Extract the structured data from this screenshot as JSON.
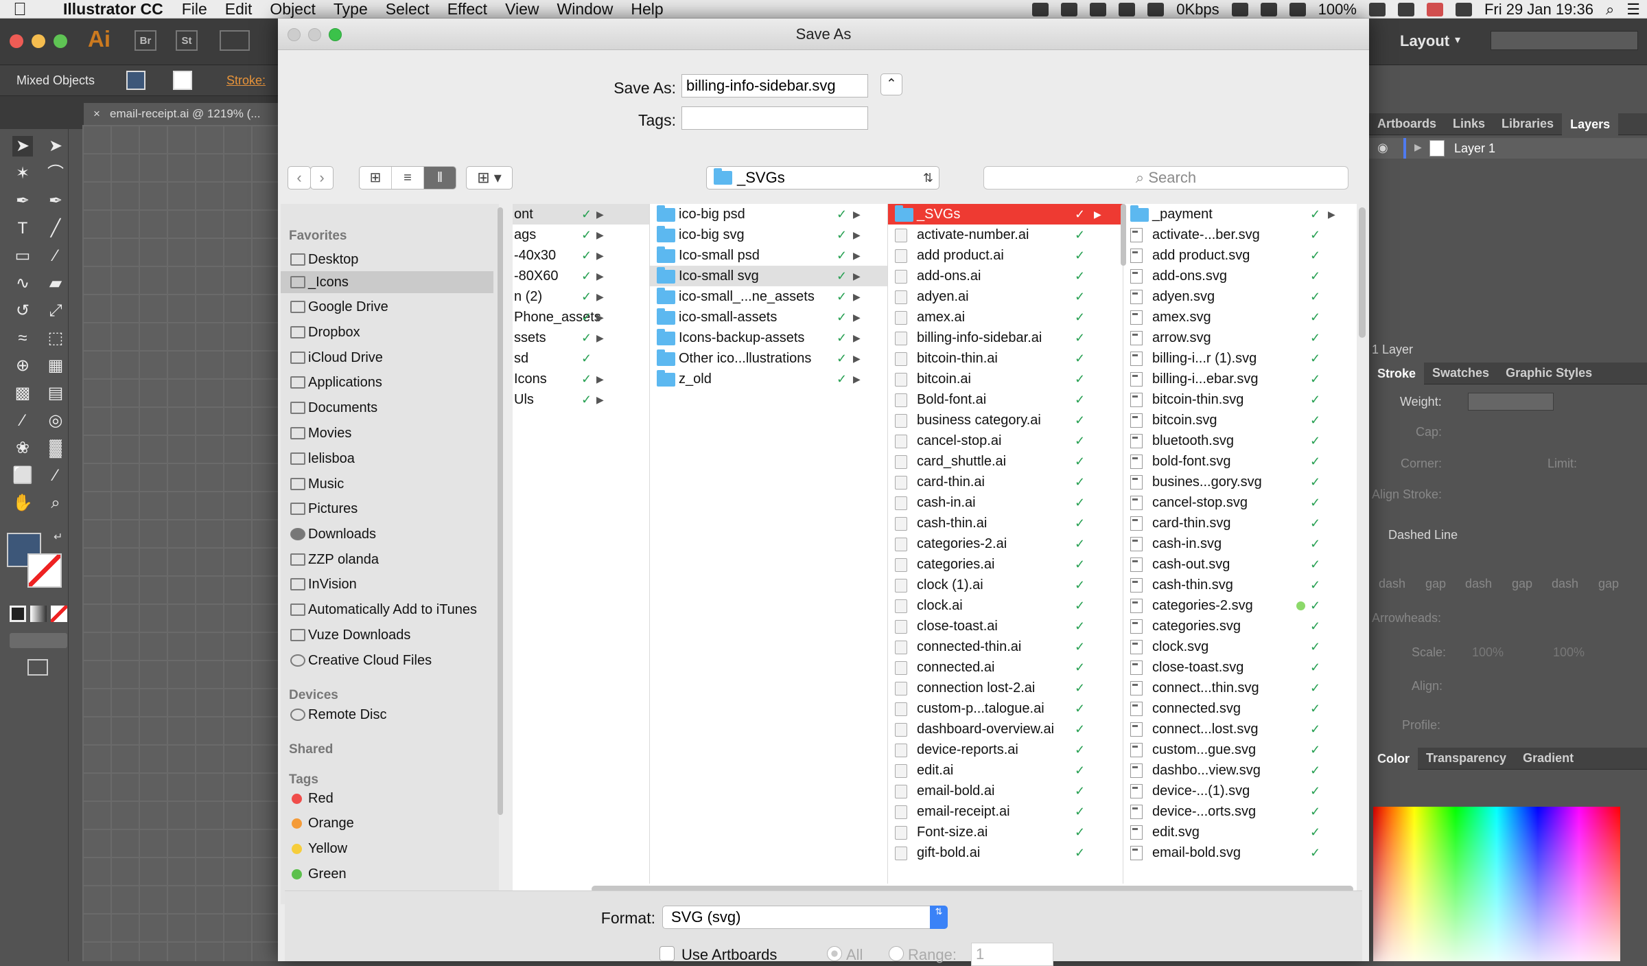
{
  "menubar": {
    "app_name": "Illustrator CC",
    "items": [
      "File",
      "Edit",
      "Object",
      "Type",
      "Select",
      "Effect",
      "View",
      "Window",
      "Help"
    ],
    "network": "0Kbps",
    "battery": "100%",
    "datetime": "Fri 29 Jan  19:36"
  },
  "ai": {
    "logo": "Ai",
    "bridge": "Br",
    "stock": "St",
    "layout": "Layout",
    "selection_label": "Mixed Objects",
    "stroke_label": "Stroke:",
    "doc_tab": "email-receipt.ai @ 1219% (..."
  },
  "panels": {
    "top_tabs": [
      "Artboards",
      "Links",
      "Libraries",
      "Layers"
    ],
    "layer_name": "Layer 1",
    "layer_count": "1 Layer",
    "stroke_tabs": [
      "Stroke",
      "Swatches",
      "Graphic Styles"
    ],
    "weight": "Weight:",
    "cap": "Cap:",
    "corner": "Corner:",
    "limit": "Limit:",
    "align_stroke": "Align Stroke:",
    "dashed_line": "Dashed Line",
    "dash_labels": [
      "dash",
      "gap",
      "dash",
      "gap",
      "dash",
      "gap"
    ],
    "arrowheads": "Arrowheads:",
    "scale": "Scale:",
    "scale_val": "100%",
    "align": "Align:",
    "profile": "Profile:",
    "color_tabs": [
      "Color",
      "Transparency",
      "Gradient"
    ]
  },
  "dialog": {
    "title": "Save As",
    "save_as_label": "Save As:",
    "save_as_value": "billing-info-sidebar.svg",
    "tags_label": "Tags:",
    "tags_value": "",
    "location": "_SVGs",
    "search_placeholder": "Search",
    "format_label": "Format:",
    "format_value": "SVG (svg)",
    "use_artboards": "Use Artboards",
    "all": "All",
    "range": "Range:",
    "range_value": "1"
  },
  "sidebar": {
    "favorites_head": "Favorites",
    "favorites": [
      "Desktop",
      "_Icons",
      "Google Drive",
      "Dropbox",
      "iCloud Drive",
      "Applications",
      "Documents",
      "Movies",
      "lelisboa",
      "Music",
      "Pictures",
      "Downloads",
      "ZZP olanda",
      "InVision",
      "Automatically Add to iTunes",
      "Vuze Downloads",
      "Creative Cloud Files"
    ],
    "devices_head": "Devices",
    "devices": [
      "Remote Disc"
    ],
    "shared_head": "Shared",
    "tags_head": "Tags",
    "tags": [
      {
        "name": "Red",
        "color": "#f04d4a"
      },
      {
        "name": "Orange",
        "color": "#f49b38"
      },
      {
        "name": "Yellow",
        "color": "#f6cd3b"
      },
      {
        "name": "Green",
        "color": "#5cc04c"
      }
    ]
  },
  "columns": {
    "col1": [
      "ont",
      "ags",
      "-40x30",
      "-80X60",
      "n (2)",
      "Phone_assets",
      "ssets",
      "sd",
      "Icons",
      "Uls"
    ],
    "col2": [
      "ico-big psd",
      "ico-big svg",
      "Ico-small psd",
      "Ico-small svg",
      "ico-small_...ne_assets",
      "ico-small-assets",
      "Icons-backup-assets",
      "Other ico...llustrations",
      "z_old"
    ],
    "col3": [
      "_SVGs",
      "activate-number.ai",
      "add product.ai",
      "add-ons.ai",
      "adyen.ai",
      "amex.ai",
      "billing-info-sidebar.ai",
      "bitcoin-thin.ai",
      "bitcoin.ai",
      "Bold-font.ai",
      "business category.ai",
      "cancel-stop.ai",
      "card_shuttle.ai",
      "card-thin.ai",
      "cash-in.ai",
      "cash-thin.ai",
      "categories-2.ai",
      "categories.ai",
      "clock (1).ai",
      "clock.ai",
      "close-toast.ai",
      "connected-thin.ai",
      "connected.ai",
      "connection lost-2.ai",
      "custom-p...talogue.ai",
      "dashboard-overview.ai",
      "device-reports.ai",
      "edit.ai",
      "email-bold.ai",
      "email-receipt.ai",
      "Font-size.ai",
      "gift-bold.ai"
    ],
    "col4": [
      "_payment",
      "activate-...ber.svg",
      "add product.svg",
      "add-ons.svg",
      "adyen.svg",
      "amex.svg",
      "arrow.svg",
      "billing-i...r (1).svg",
      "billing-i...ebar.svg",
      "bitcoin-thin.svg",
      "bitcoin.svg",
      "bluetooth.svg",
      "bold-font.svg",
      "busines...gory.svg",
      "cancel-stop.svg",
      "card-thin.svg",
      "cash-in.svg",
      "cash-out.svg",
      "cash-thin.svg",
      "categories-2.svg",
      "categories.svg",
      "clock.svg",
      "close-toast.svg",
      "connect...thin.svg",
      "connected.svg",
      "connect...lost.svg",
      "custom...gue.svg",
      "dashbo...view.svg",
      "device-...(1).svg",
      "device-...orts.svg",
      "edit.svg",
      "email-bold.svg"
    ]
  },
  "colors": {
    "accent": "#3a82f7",
    "selected_row": "#ee3a32",
    "check": "#27a052",
    "folder": "#5cb8f0"
  }
}
